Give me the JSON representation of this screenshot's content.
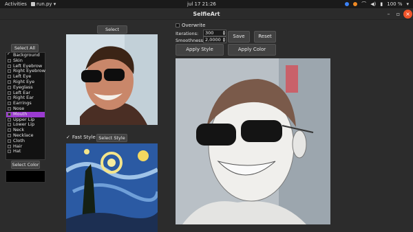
{
  "topbar": {
    "activities": "Activities",
    "app_menu": "run.py ▾",
    "clock": "jul 17  21:26",
    "battery": "100 %"
  },
  "window": {
    "title": "SelfieArt",
    "minimize": "–",
    "maximize": "▫",
    "close": "×"
  },
  "left": {
    "select_all": "Select All",
    "parts": [
      {
        "label": "Background",
        "checked": true
      },
      {
        "label": "Skin",
        "checked": false
      },
      {
        "label": "Left Eyebrow",
        "checked": false
      },
      {
        "label": "Right Eyebrow",
        "checked": false
      },
      {
        "label": "Left Eye",
        "checked": false
      },
      {
        "label": "Right Eye",
        "checked": false
      },
      {
        "label": "Eyeglass",
        "checked": false
      },
      {
        "label": "Left Ear",
        "checked": false
      },
      {
        "label": "Right Ear",
        "checked": false
      },
      {
        "label": "Earrings",
        "checked": false
      },
      {
        "label": "Nose",
        "checked": false
      },
      {
        "label": "Mouth",
        "checked": false,
        "selected": true
      },
      {
        "label": "Upper Lip",
        "checked": false
      },
      {
        "label": "Lower Lip",
        "checked": false
      },
      {
        "label": "Neck",
        "checked": false
      },
      {
        "label": "Necklace",
        "checked": false
      },
      {
        "label": "Cloth",
        "checked": false
      },
      {
        "label": "Hair",
        "checked": false
      },
      {
        "label": "Hat",
        "checked": false
      }
    ],
    "select_color": "Select Color",
    "color": "#000000"
  },
  "middle": {
    "select_image": "Select Image",
    "fast_style": "Fast Style",
    "fast_style_checked": true,
    "select_style": "Select Style"
  },
  "right": {
    "overwrite": "Overwrite",
    "iterations_label": "Iterations:",
    "iterations_value": "300",
    "smoothness_label": "Smoothness:",
    "smoothness_value": "2,0000",
    "save": "Save",
    "reset": "Reset",
    "apply_style": "Apply Style",
    "apply_color": "Apply Color"
  },
  "colors": {
    "accent_selection": "#9b3bd1",
    "close_button": "#f0542a"
  }
}
